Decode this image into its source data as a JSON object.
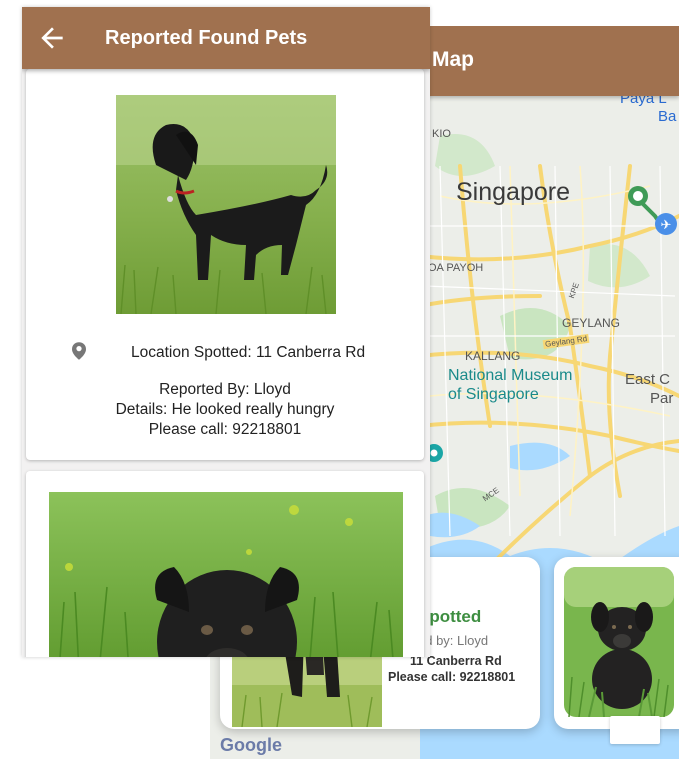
{
  "map_screen": {
    "title": "Map",
    "labels": {
      "paya": "Paya L",
      "ba": "Ba",
      "kio": "KIO",
      "city": "Singapore",
      "toa_payoh": "OA PAYOH",
      "kpe": "KPE",
      "geylang": "GEYLANG",
      "geylang_rd": "Geylang Rd",
      "kallang": "KALLANG",
      "museum_line1": "National Museum",
      "museum_line2": "of Singapore",
      "east_c": "East C",
      "par": "Par",
      "mce": "MCE"
    },
    "card": {
      "title_partial": "Spotted",
      "reported_partial": "ed by: Lloyd",
      "address": "11 Canberra Rd",
      "call": "Please call: 92218801"
    },
    "google_logo": "Google",
    "colors": {
      "appbar": "#a0714f",
      "spotted_title": "#3e8e41",
      "water": "#aadaff"
    }
  },
  "list_screen": {
    "title": "Reported Found Pets",
    "back_icon": "arrow-left",
    "pets": [
      {
        "location": "Location Spotted: 11 Canberra Rd",
        "reported_by": "Reported By: Lloyd",
        "details": "Details: He looked really hungry",
        "call": "Please call: 92218801",
        "photo": "black labrador standing in grass"
      },
      {
        "photo": "black puppy in grass"
      }
    ]
  }
}
